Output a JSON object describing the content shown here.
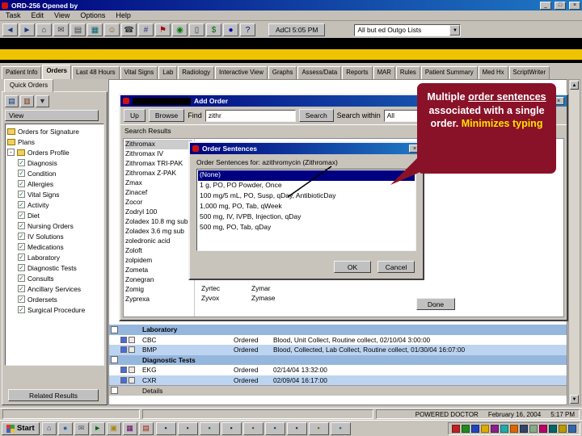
{
  "window": {
    "title": "ORD-256 Opened by",
    "minimize": "_",
    "maximize": "□",
    "close": "×"
  },
  "menu": {
    "items": [
      {
        "label": "Task"
      },
      {
        "label": "Edit"
      },
      {
        "label": "View"
      },
      {
        "label": "Options"
      },
      {
        "label": "Help"
      }
    ]
  },
  "toolbar": {
    "icons": [
      {
        "name": "back-icon",
        "glyph": "◄",
        "color": "#1a3a7a"
      },
      {
        "name": "forward-icon",
        "glyph": "►",
        "color": "#1a3a7a"
      },
      {
        "name": "home-icon",
        "glyph": "⌂",
        "color": "#333333"
      },
      {
        "name": "mail-icon",
        "glyph": "✉",
        "color": "#444444"
      },
      {
        "name": "print-icon",
        "glyph": "▤",
        "color": "#444444"
      },
      {
        "name": "chart-icon",
        "glyph": "▦",
        "color": "#066666"
      },
      {
        "name": "patient-icon",
        "glyph": "☺",
        "color": "#885500"
      },
      {
        "name": "phone-icon",
        "glyph": "☎",
        "color": "#333333"
      },
      {
        "name": "grid-icon",
        "glyph": "#",
        "color": "#333388"
      },
      {
        "name": "flag-icon",
        "glyph": "⚑",
        "color": "#aa0000"
      },
      {
        "name": "med-icon",
        "glyph": "◉",
        "color": "#007700"
      },
      {
        "name": "document-icon",
        "glyph": "▯",
        "color": "#333333"
      },
      {
        "name": "billing-icon",
        "glyph": "$",
        "color": "#006600"
      },
      {
        "name": "info-icon",
        "glyph": "●",
        "color": "#0000aa"
      },
      {
        "name": "help-icon",
        "glyph": "?",
        "color": "#000066"
      }
    ],
    "clock_button": "AdCl  5:05 PM",
    "list_combo": "All but ed Outgo Lists"
  },
  "tabs": {
    "items": [
      {
        "label": "Patient Info"
      },
      {
        "label": "Orders",
        "active": true
      },
      {
        "label": "Last 48 Hours"
      },
      {
        "label": "Vital Signs"
      },
      {
        "label": "Lab"
      },
      {
        "label": "Radiology"
      },
      {
        "label": "Interactive View"
      },
      {
        "label": "Graphs"
      },
      {
        "label": "Assess/Data"
      },
      {
        "label": "Reports"
      },
      {
        "label": "MAR"
      },
      {
        "label": "Rules"
      },
      {
        "label": "Patient Summary"
      },
      {
        "label": "Med Hx"
      },
      {
        "label": "ScriptWriter"
      }
    ]
  },
  "left_panel": {
    "tab_label": "Quick Orders",
    "icons": [
      {
        "name": "list-view-icon",
        "glyph": "▤",
        "color": "#003377"
      },
      {
        "name": "profile-view-icon",
        "glyph": "▥",
        "color": "#773300"
      },
      {
        "name": "filter-icon",
        "glyph": "▼",
        "color": "#333333"
      }
    ],
    "view_label": "View",
    "roots": [
      {
        "label": "Orders for Signature"
      },
      {
        "label": "Plans"
      },
      {
        "label": "Orders Profile"
      }
    ],
    "profile_items": [
      {
        "label": "Diagnosis"
      },
      {
        "label": "Condition"
      },
      {
        "label": "Allergies"
      },
      {
        "label": "Vital Signs"
      },
      {
        "label": "Activity"
      },
      {
        "label": "Diet"
      },
      {
        "label": "Nursing Orders"
      },
      {
        "label": "IV Solutions"
      },
      {
        "label": "Medications"
      },
      {
        "label": "Laboratory"
      },
      {
        "label": "Diagnostic Tests"
      },
      {
        "label": "Consults"
      },
      {
        "label": "Ancillary Services"
      },
      {
        "label": "Ordersets"
      },
      {
        "label": "Surgical Procedure"
      }
    ],
    "related_results": "Related Results"
  },
  "add_order": {
    "title": "Add Order",
    "up": "Up",
    "browse": "Browse",
    "find_label": "Find",
    "search_value": "zithr",
    "search_button": "Search",
    "within_label": "Search within",
    "within_value": "All",
    "results_header": "Search Results",
    "results": [
      {
        "label": "Zithromax",
        "active": true
      },
      {
        "label": "Zithromax IV"
      },
      {
        "label": "Zithromax TRI-PAK"
      },
      {
        "label": "Zithromax Z-PAK"
      },
      {
        "label": "Zmax"
      },
      {
        "label": "Zinacef"
      },
      {
        "label": "Zocor"
      },
      {
        "label": "Zodryl 100"
      },
      {
        "label": "Zoladex 10.8 mg sub"
      },
      {
        "label": "Zoladex 3.6 mg sub"
      },
      {
        "label": "zoledronic acid"
      },
      {
        "label": "Zoloft"
      },
      {
        "label": "zolpidem"
      },
      {
        "label": "Zometa"
      },
      {
        "label": "Zonegran"
      },
      {
        "label": "Zomig"
      },
      {
        "label": "Zyprexa"
      }
    ],
    "extra_results": [
      {
        "label": "Zyrtec"
      },
      {
        "label": "Zymar"
      },
      {
        "label": "Zyvox"
      },
      {
        "label": "Zymase"
      }
    ],
    "done": "Done"
  },
  "order_sentences": {
    "title": "Order Sentences",
    "for_label": "Order Sentences for:  azithromycin (Zithromax)",
    "items": [
      {
        "label": "(None)",
        "active": true
      },
      {
        "label": "1 g, PO, PO Powder, Once"
      },
      {
        "label": "100 mg/5 mL, PO, Susp, qDay, AntibioticDay"
      },
      {
        "label": "1,000 mg, PO, Tab, qWeek"
      },
      {
        "label": "500 mg, IV, IVPB, Injection, qDay"
      },
      {
        "label": "500 mg, PO, Tab, qDay"
      }
    ],
    "ok": "OK",
    "cancel": "Cancel",
    "close": "×"
  },
  "callout": {
    "text_before": "Multiple ",
    "underlined": "order sentences",
    "text_after": " associated with a single order. ",
    "highlight": "Minimizes typing",
    "bg_color": "#8A1228",
    "highlight_color": "#FFE000"
  },
  "orders": {
    "rows": [
      {
        "type": "section",
        "name": "Laboratory",
        "status": "",
        "details": ""
      },
      {
        "type": "white",
        "name": "CBC",
        "status": "Ordered",
        "details": "Blood, Unit Collect, Routine collect, 02/10/04 3:00:00"
      },
      {
        "type": "blue",
        "name": "BMP",
        "status": "Ordered",
        "details": "Blood, Collected, Lab Collect, Routine collect, 01/30/04 16:07:00"
      },
      {
        "type": "section",
        "name": "Diagnostic Tests",
        "status": "",
        "details": ""
      },
      {
        "type": "white",
        "name": "EKG",
        "status": "Ordered",
        "details": "02/14/04 13:32:00"
      },
      {
        "type": "blue",
        "name": "CXR",
        "status": "Ordered",
        "details": "02/09/04 16:17:00"
      },
      {
        "type": "details",
        "name": "Details",
        "status": "",
        "details": ""
      }
    ]
  },
  "status_bar": {
    "user": "POWERED  DOCTOR",
    "date": "February 16, 2004",
    "time": "5:17 PM"
  },
  "taskbar": {
    "start": "Start",
    "quick_icons": [
      {
        "name": "desktop-icon",
        "glyph": "⌂",
        "color": "#334477"
      },
      {
        "name": "browser-icon",
        "glyph": "●",
        "color": "#2266aa"
      },
      {
        "name": "mail-icon",
        "glyph": "✉",
        "color": "#555555"
      },
      {
        "name": "media-icon",
        "glyph": "►",
        "color": "#006600"
      },
      {
        "name": "folder-icon",
        "glyph": "▣",
        "color": "#aa8800"
      },
      {
        "name": "chart-app-icon",
        "glyph": "▦",
        "color": "#660066"
      },
      {
        "name": "notes-icon",
        "glyph": "▤",
        "color": "#aa2200"
      }
    ],
    "task_buttons": [
      {
        "name": "taskbar-window-button",
        "glyph": "▪",
        "color": "#223366"
      },
      {
        "name": "taskbar-window-button",
        "glyph": "▪",
        "color": "#663322"
      },
      {
        "name": "taskbar-window-button",
        "glyph": "▪",
        "color": "#226633"
      },
      {
        "name": "taskbar-window-button",
        "glyph": "▪",
        "color": "#333333"
      },
      {
        "name": "taskbar-window-button",
        "glyph": "▪",
        "color": "#884422"
      },
      {
        "name": "taskbar-window-button",
        "glyph": "▪",
        "color": "#224488"
      },
      {
        "name": "taskbar-window-button",
        "glyph": "▪",
        "color": "#552266"
      },
      {
        "name": "taskbar-window-button",
        "glyph": "▪",
        "color": "#886600"
      },
      {
        "name": "taskbar-window-button",
        "glyph": "▪",
        "color": "#336666"
      }
    ],
    "tray_icons": [
      {
        "name": "tray-icon",
        "color": "#bb2222"
      },
      {
        "name": "tray-icon",
        "color": "#228822"
      },
      {
        "name": "tray-icon",
        "color": "#2244bb"
      },
      {
        "name": "tray-icon",
        "color": "#ddaa00"
      },
      {
        "name": "tray-icon",
        "color": "#882288"
      },
      {
        "name": "tray-icon",
        "color": "#22aaaa"
      },
      {
        "name": "tray-icon",
        "color": "#dd6600"
      },
      {
        "name": "tray-icon",
        "color": "#334466"
      },
      {
        "name": "tray-icon",
        "color": "#88aa88"
      },
      {
        "name": "tray-icon",
        "color": "#bb0066"
      },
      {
        "name": "tray-icon",
        "color": "#006666"
      },
      {
        "name": "tray-icon",
        "color": "#bb9900"
      },
      {
        "name": "tray-icon",
        "color": "#3366aa"
      }
    ]
  }
}
